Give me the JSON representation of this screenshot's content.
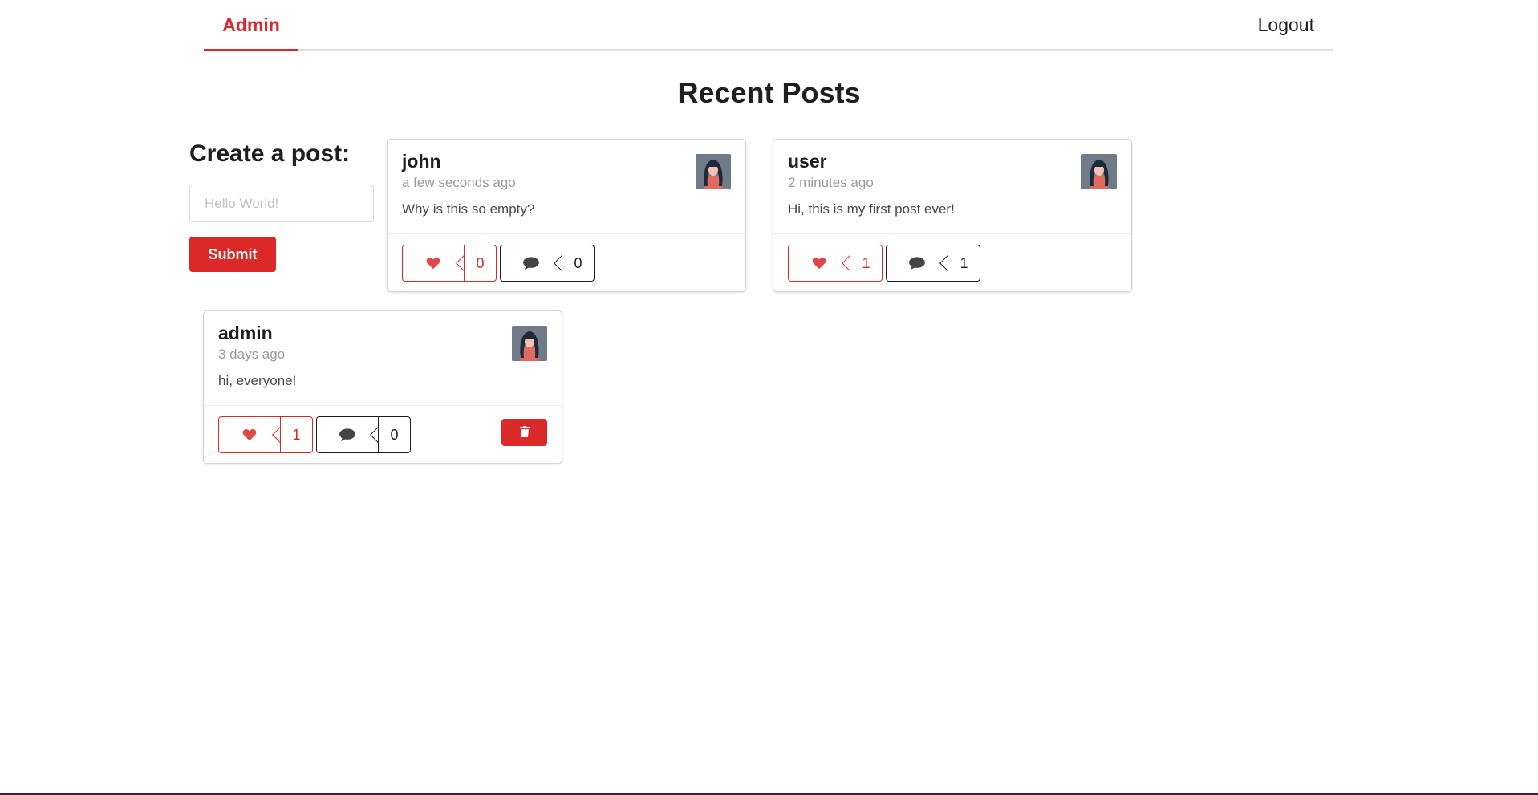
{
  "nav": {
    "admin_label": "Admin",
    "logout_label": "Logout"
  },
  "page_title": "Recent Posts",
  "create": {
    "heading": "Create a post:",
    "placeholder": "Hello World!",
    "submit_label": "Submit"
  },
  "posts": [
    {
      "author": "john",
      "time": "a few seconds ago",
      "body": "Why is this so empty?",
      "likes": "0",
      "comments": "0"
    },
    {
      "author": "user",
      "time": "2 minutes ago",
      "body": "Hi, this is my first post ever!",
      "likes": "1",
      "comments": "1"
    },
    {
      "author": "admin",
      "time": "3 days ago",
      "body": "hi, everyone!",
      "likes": "1",
      "comments": "0"
    }
  ],
  "icons": {
    "like": "heart-icon",
    "comment": "comment-icon",
    "delete": "trash-icon"
  },
  "colors": {
    "accent": "#db2828",
    "text": "#1f1f1f",
    "muted": "#9a9a9a"
  }
}
